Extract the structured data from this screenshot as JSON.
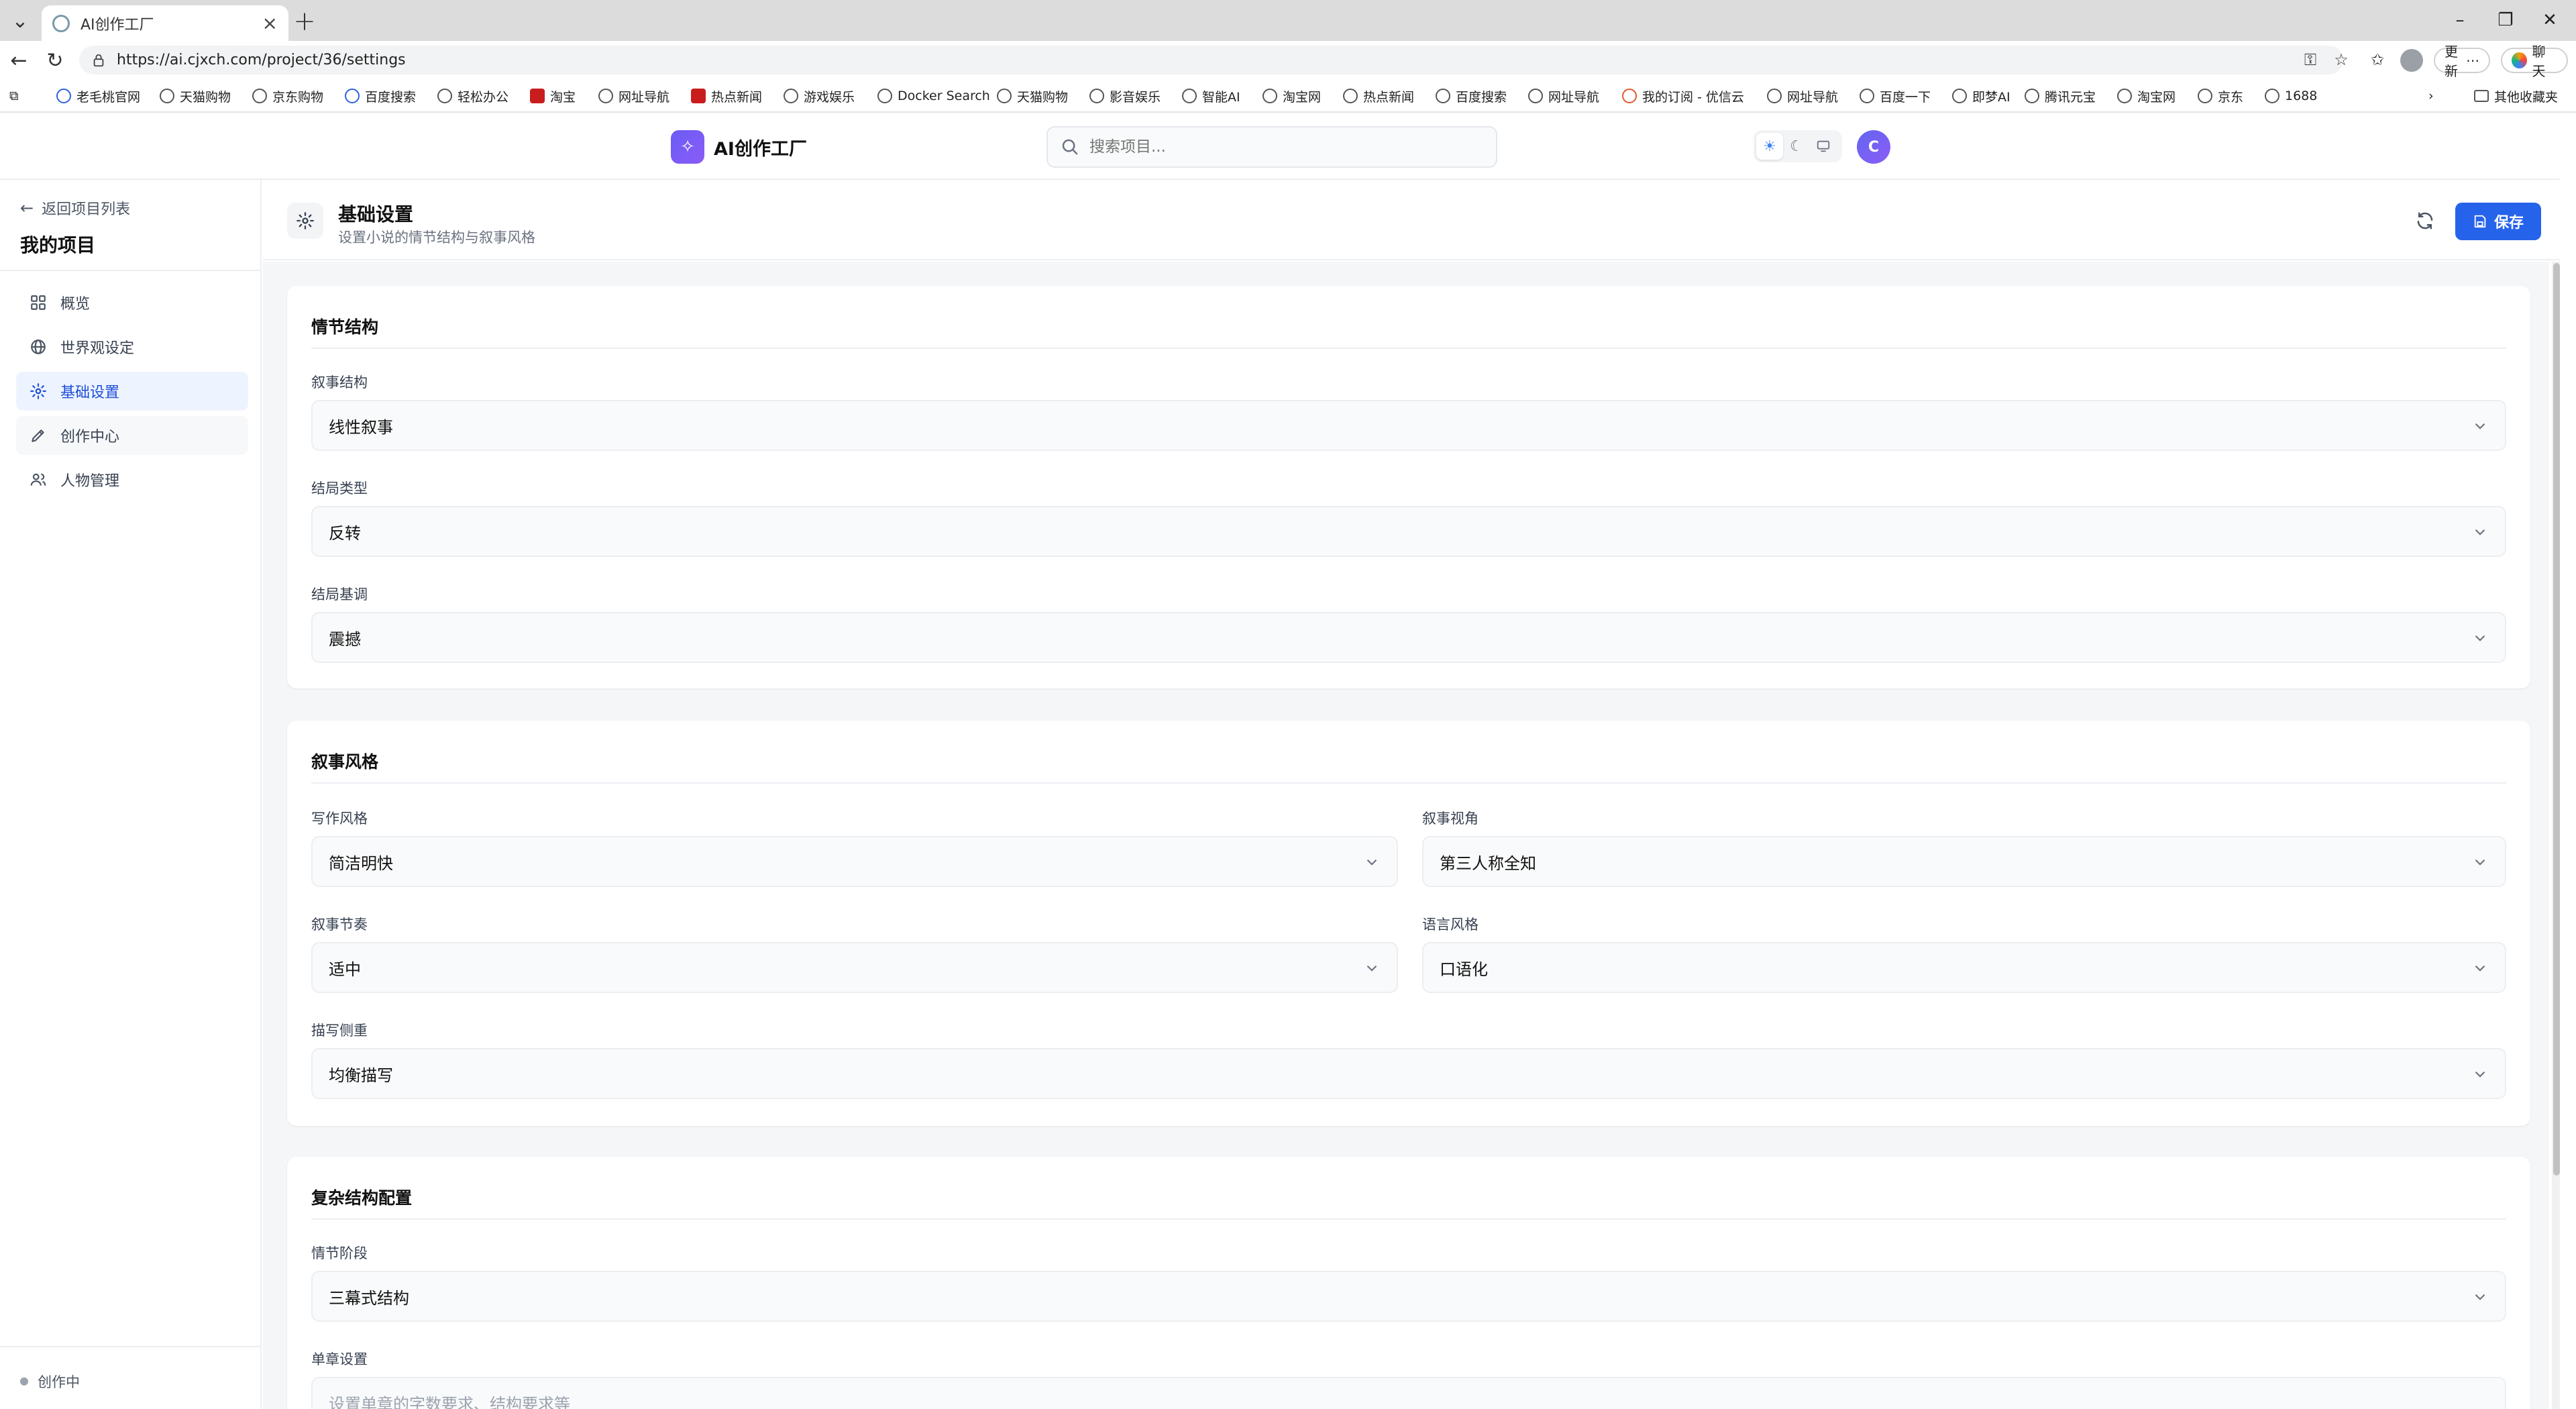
{
  "browser": {
    "tab_title": "AI创作工厂",
    "url": "https://ai.cjxch.com/project/36/settings",
    "update_label": "更新",
    "chat_label": "聊天",
    "other_bookmarks": "其他收藏夹",
    "bookmarks": [
      "老毛桃官网",
      "天猫购物",
      "京东购物",
      "百度搜索",
      "轻松办公",
      "淘宝",
      "网址导航",
      "热点新闻",
      "游戏娱乐",
      "Docker Search",
      "天猫购物",
      "影音娱乐",
      "智能AI",
      "淘宝网",
      "热点新闻",
      "百度搜索",
      "网址导航",
      "我的订阅 - 优信云",
      "网址导航",
      "百度一下",
      "即梦AI",
      "腾讯元宝",
      "淘宝网",
      "京东",
      "1688"
    ]
  },
  "header": {
    "logo_text": "AI创作工厂",
    "search_placeholder": "搜索项目...",
    "avatar_letter": "C"
  },
  "sidebar": {
    "back_label": "返回项目列表",
    "project_title": "我的项目",
    "items": [
      {
        "label": "概览",
        "icon": "grid-icon"
      },
      {
        "label": "世界观设定",
        "icon": "globe-icon"
      },
      {
        "label": "基础设置",
        "icon": "gear-icon"
      },
      {
        "label": "创作中心",
        "icon": "pen-icon"
      },
      {
        "label": "人物管理",
        "icon": "users-icon"
      }
    ],
    "active_index": 2,
    "status_label": "创作中"
  },
  "page": {
    "title": "基础设置",
    "subtitle": "设置小说的情节结构与叙事风格",
    "save_label": "保存"
  },
  "sections": {
    "plot": {
      "title": "情节结构",
      "narrative_structure": {
        "label": "叙事结构",
        "value": "线性叙事"
      },
      "ending_type": {
        "label": "结局类型",
        "value": "反转"
      },
      "ending_tone": {
        "label": "结局基调",
        "value": "震撼"
      }
    },
    "style": {
      "title": "叙事风格",
      "writing_style": {
        "label": "写作风格",
        "value": "简洁明快"
      },
      "perspective": {
        "label": "叙事视角",
        "value": "第三人称全知"
      },
      "pacing": {
        "label": "叙事节奏",
        "value": "适中"
      },
      "language_style": {
        "label": "语言风格",
        "value": "口语化"
      },
      "description_focus": {
        "label": "描写侧重",
        "value": "均衡描写"
      }
    },
    "complex": {
      "title": "复杂结构配置",
      "plot_stage": {
        "label": "情节阶段",
        "value": "三幕式结构"
      },
      "chapter_settings": {
        "label": "单章设置",
        "placeholder": "设置单章的字数要求、结构要求等"
      }
    }
  },
  "colors": {
    "accent": "#2563eb",
    "active_nav_bg": "#eef4ff",
    "logo_gradient_start": "#6b5cf6"
  }
}
